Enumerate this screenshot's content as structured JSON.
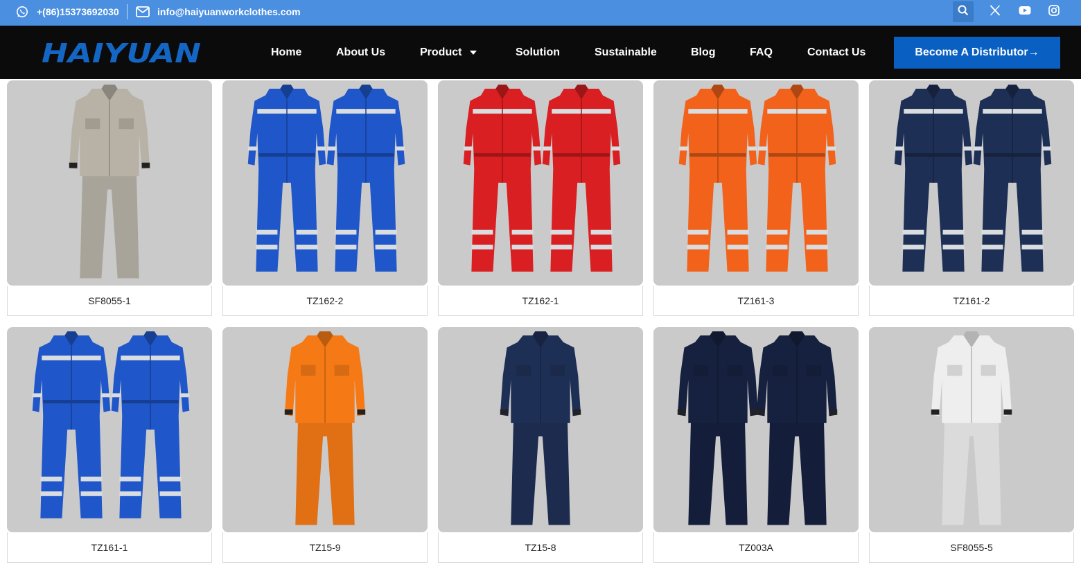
{
  "topbar": {
    "phone": "+(86)15373692030",
    "email": "info@haiyuanworkclothes.com",
    "icons": [
      "whatsapp-icon",
      "mail-icon",
      "search-icon",
      "x-twitter-icon",
      "youtube-icon",
      "instagram-icon"
    ]
  },
  "header": {
    "logo_text": "HAIYUAN",
    "nav": {
      "home": "Home",
      "about": "About Us",
      "product": "Product",
      "solution": "Solution",
      "sustainable": "Sustainable",
      "blog": "Blog",
      "faq": "FAQ",
      "contact": "Contact Us"
    },
    "cta": "Become A Distributor→"
  },
  "colors": {
    "topbar": "#4a8fe0",
    "navbar": "#0b0b0b",
    "cta": "#0a5fc2",
    "logo": "#1466c4",
    "thumb_bg": "#cacaca"
  },
  "products": [
    {
      "code": "SF8055-1",
      "style": "suit",
      "color": "#b8b2a6",
      "views": 1
    },
    {
      "code": "TZ162-2",
      "style": "coverall",
      "color": "#1f56c9",
      "views": 2
    },
    {
      "code": "TZ162-1",
      "style": "coverall",
      "color": "#d91f22",
      "views": 2
    },
    {
      "code": "TZ161-3",
      "style": "coverall",
      "color": "#f2621a",
      "views": 2
    },
    {
      "code": "TZ161-2",
      "style": "coverall",
      "color": "#1e2f55",
      "views": 2
    },
    {
      "code": "TZ161-1",
      "style": "coverall",
      "color": "#1f56c9",
      "views": 2
    },
    {
      "code": "TZ15-9",
      "style": "suit",
      "color": "#f57a16",
      "views": 1
    },
    {
      "code": "TZ15-8",
      "style": "suit",
      "color": "#1e2f55",
      "views": 1
    },
    {
      "code": "TZ003A",
      "style": "suit",
      "color": "#16213f",
      "views": 2
    },
    {
      "code": "SF8055-5",
      "style": "suit",
      "color": "#eeeeee",
      "views": 1
    }
  ]
}
